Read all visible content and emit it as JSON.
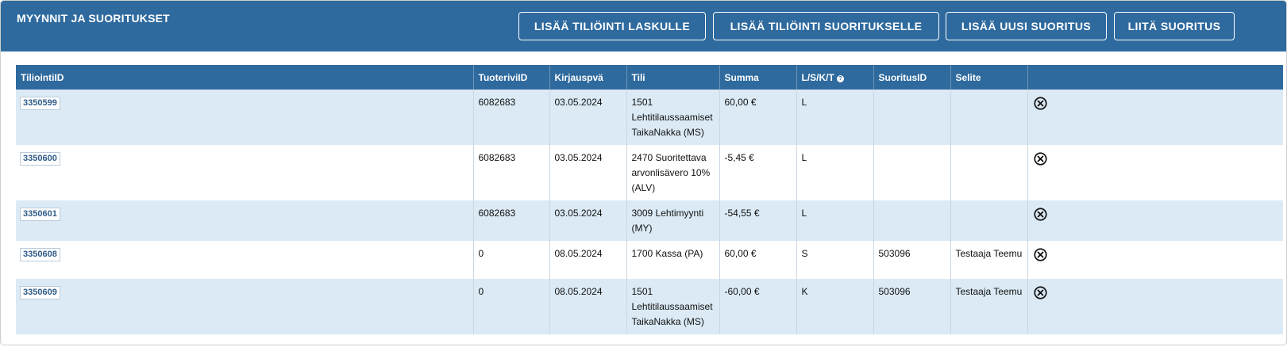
{
  "header": {
    "title": "MYYNNIT JA SUORITUKSET",
    "buttons": {
      "add_invoice_posting": "LISÄÄ TILIÖINTI LASKULLE",
      "add_payment_posting": "LISÄÄ TILIÖINTI SUORITUKSELLE",
      "add_new_payment": "LISÄÄ UUSI SUORITUS",
      "attach_payment": "LIITÄ SUORITUS"
    }
  },
  "table": {
    "columns": {
      "tiliointi_id": "TiliointiID",
      "tuoterivi_id": "TuoteriviID",
      "kirjauspva": "Kirjauspvä",
      "tili": "Tili",
      "summa": "Summa",
      "lskt": "L/S/K/T",
      "lskt_help": "?",
      "suoritus_id": "SuoritusID",
      "selite": "Selite"
    },
    "rows": [
      {
        "id": "3350599",
        "tuoterivi": "6082683",
        "pvm": "03.05.2024",
        "tili": "1501 Lehtitilaussaamiset TaikaNakka (MS)",
        "summa": "60,00 €",
        "tyyppi": "L",
        "suoritus": "",
        "selite": ""
      },
      {
        "id": "3350600",
        "tuoterivi": "6082683",
        "pvm": "03.05.2024",
        "tili": "2470 Suoritettava arvonlisävero 10% (ALV)",
        "summa": "-5,45 €",
        "tyyppi": "L",
        "suoritus": "",
        "selite": ""
      },
      {
        "id": "3350601",
        "tuoterivi": "6082683",
        "pvm": "03.05.2024",
        "tili": "3009 Lehtimyynti (MY)",
        "summa": "-54,55 €",
        "tyyppi": "L",
        "suoritus": "",
        "selite": ""
      },
      {
        "id": "3350608",
        "tuoterivi": "0",
        "pvm": "08.05.2024",
        "tili": "1700 Kassa (PA)",
        "summa": "60,00 €",
        "tyyppi": "S",
        "suoritus": "503096",
        "selite": "Testaaja Teemu"
      },
      {
        "id": "3350609",
        "tuoterivi": "0",
        "pvm": "08.05.2024",
        "tili": "1501 Lehtitilaussaamiset TaikaNakka (MS)",
        "summa": "-60,00 €",
        "tyyppi": "K",
        "suoritus": "503096",
        "selite": "Testaaja Teemu"
      }
    ]
  },
  "icons": {
    "delete": "close-circle-icon",
    "help": "help-icon"
  },
  "colors": {
    "header_bg": "#2e6a9e",
    "row_alt_bg": "#dbeaf5"
  }
}
